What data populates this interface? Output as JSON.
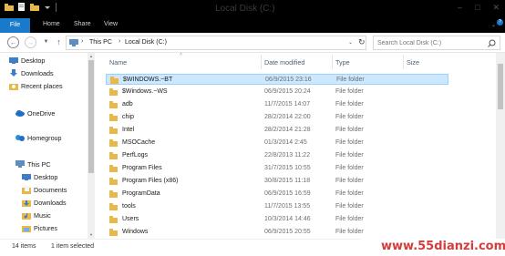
{
  "window": {
    "title": "Local Disk (C:)"
  },
  "ribbon": {
    "tabs": [
      "File",
      "Home",
      "Share",
      "View"
    ]
  },
  "address": {
    "crumbs": [
      "This PC",
      "Local Disk (C:)"
    ]
  },
  "search": {
    "placeholder": "Search Local Disk (C:)"
  },
  "nav": {
    "items": [
      {
        "label": "Desktop",
        "icon": "desktop-icon"
      },
      {
        "label": "Downloads",
        "icon": "downloads-icon"
      },
      {
        "label": "Recent places",
        "icon": "recent-places-icon"
      },
      {
        "label": "OneDrive",
        "icon": "onedrive-icon"
      },
      {
        "label": "Homegroup",
        "icon": "homegroup-icon"
      },
      {
        "label": "This PC",
        "icon": "this-pc-icon"
      },
      {
        "label": "Desktop",
        "icon": "desktop-icon"
      },
      {
        "label": "Documents",
        "icon": "documents-icon"
      },
      {
        "label": "Downloads",
        "icon": "downloads-icon"
      },
      {
        "label": "Music",
        "icon": "music-icon"
      },
      {
        "label": "Pictures",
        "icon": "pictures-icon"
      }
    ]
  },
  "columns": {
    "name": "Name",
    "date": "Date modified",
    "type": "Type",
    "size": "Size"
  },
  "files": [
    {
      "name": "$WINDOWS.~BT",
      "date": "06/9/2015 23:16",
      "type": "File folder",
      "selected": true
    },
    {
      "name": "$Windows.~WS",
      "date": "06/9/2015 20:24",
      "type": "File folder"
    },
    {
      "name": "adb",
      "date": "11/7/2015 14:07",
      "type": "File folder"
    },
    {
      "name": "chip",
      "date": "28/2/2014 22:00",
      "type": "File folder"
    },
    {
      "name": "Intel",
      "date": "28/2/2014 21:28",
      "type": "File folder"
    },
    {
      "name": "MSOCache",
      "date": "01/3/2014 2:45",
      "type": "File folder"
    },
    {
      "name": "PerfLogs",
      "date": "22/8/2013 11:22",
      "type": "File folder"
    },
    {
      "name": "Program Files",
      "date": "31/7/2015 10:55",
      "type": "File folder"
    },
    {
      "name": "Program Files (x86)",
      "date": "30/8/2015 11:18",
      "type": "File folder"
    },
    {
      "name": "ProgramData",
      "date": "06/9/2015 16:59",
      "type": "File folder"
    },
    {
      "name": "tools",
      "date": "11/7/2015 13:55",
      "type": "File folder"
    },
    {
      "name": "Users",
      "date": "10/3/2014 14:46",
      "type": "File folder"
    },
    {
      "name": "Windows",
      "date": "06/9/2015 20:55",
      "type": "File folder"
    }
  ],
  "status": {
    "count": "14 items",
    "selected": "1 item selected"
  },
  "watermark": {
    "text": "www.55dianzi.com"
  },
  "colors": {
    "file_tab": "#1979ca",
    "selection": "#cce8ff",
    "folder": "#e8b84a"
  }
}
